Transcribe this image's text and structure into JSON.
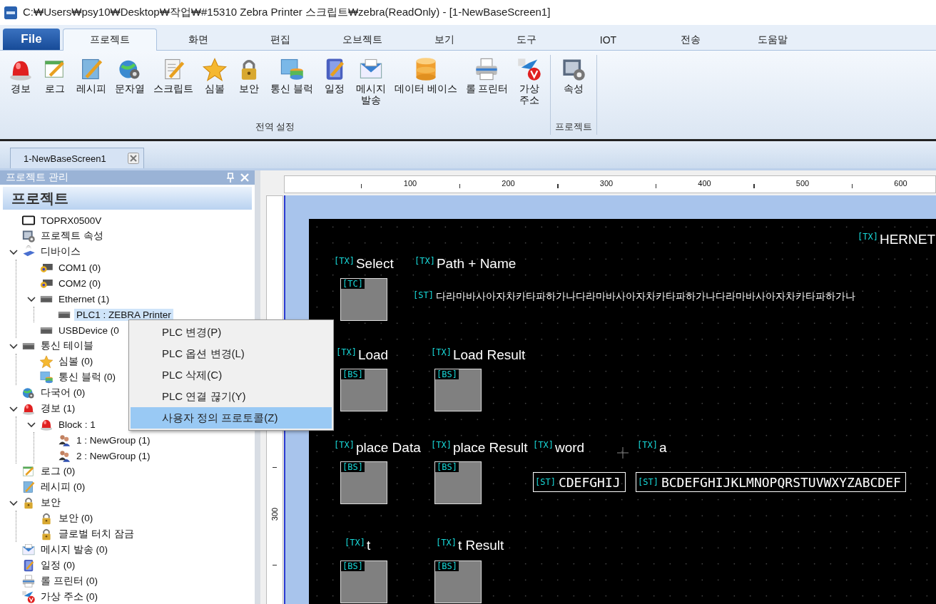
{
  "window": {
    "title": "C:₩Users₩psy10₩Desktop₩작업₩#15310 Zebra Printer 스크립트₩zebra(ReadOnly) - [1-NewBaseScreen1]"
  },
  "ribbon": {
    "tabs": [
      {
        "label": "File",
        "kind": "file",
        "selected": false
      },
      {
        "label": "프로젝트",
        "kind": "tab",
        "selected": true
      },
      {
        "label": "화면",
        "kind": "tab",
        "selected": false
      },
      {
        "label": "편집",
        "kind": "tab",
        "selected": false
      },
      {
        "label": "오브젝트",
        "kind": "tab",
        "selected": false
      },
      {
        "label": "보기",
        "kind": "tab",
        "selected": false
      },
      {
        "label": "도구",
        "kind": "tab",
        "selected": false
      },
      {
        "label": "IOT",
        "kind": "tab",
        "selected": false
      },
      {
        "label": "전송",
        "kind": "tab",
        "selected": false
      },
      {
        "label": "도움말",
        "kind": "tab",
        "selected": false
      }
    ],
    "groups": [
      {
        "label": "전역 설정",
        "buttons": [
          {
            "label": "경보",
            "kind": "alarm"
          },
          {
            "label": "로그",
            "kind": "log"
          },
          {
            "label": "레시피",
            "kind": "recipe"
          },
          {
            "label": "문자열",
            "kind": "globe"
          },
          {
            "label": "스크립트",
            "kind": "script"
          },
          {
            "label": "심볼",
            "kind": "star"
          },
          {
            "label": "보안",
            "kind": "lock"
          },
          {
            "label": "통신 블럭",
            "kind": "db"
          },
          {
            "label": "일정",
            "kind": "schedule"
          },
          {
            "label": "메시지\n발송",
            "kind": "mail"
          },
          {
            "label": "데이터 베이스",
            "kind": "database"
          },
          {
            "label": "롤 프린터",
            "kind": "printer"
          },
          {
            "label": "가상\n주소",
            "kind": "vaddr"
          }
        ]
      },
      {
        "label": "프로젝트",
        "buttons": [
          {
            "label": "속성",
            "kind": "settings"
          }
        ]
      }
    ]
  },
  "document_tabs": [
    {
      "label": "1-NewBaseScreen1",
      "selected": true
    }
  ],
  "project_panel": {
    "title": "프로젝트 관리",
    "header": "프로젝트",
    "tree": [
      {
        "label": "TOPRX0500V",
        "kind": "monitor",
        "selected": false
      },
      {
        "label": "프로젝트 속성",
        "kind": "settings",
        "selected": false
      },
      {
        "label": "디바이스",
        "kind": "network",
        "selected": false,
        "expanded": true,
        "children": [
          {
            "label": "COM1 (0)",
            "kind": "port",
            "selected": false
          },
          {
            "label": "COM2 (0)",
            "kind": "port",
            "selected": false
          },
          {
            "label": "Ethernet (1)",
            "kind": "device",
            "selected": false,
            "expanded": true,
            "children": [
              {
                "label": "PLC1 : ZEBRA Printer",
                "kind": "device",
                "selected": true
              }
            ]
          },
          {
            "label": "USBDevice (0",
            "kind": "device",
            "selected": false
          }
        ]
      },
      {
        "label": "통신 테이블",
        "kind": "device",
        "selected": false,
        "expanded": true,
        "children": [
          {
            "label": "심볼 (0)",
            "kind": "star",
            "selected": false
          },
          {
            "label": "통신 블럭 (0)",
            "kind": "db",
            "selected": false
          }
        ]
      },
      {
        "label": "다국어 (0)",
        "kind": "globe",
        "selected": false
      },
      {
        "label": "경보 (1)",
        "kind": "alarm",
        "selected": false,
        "expanded": true,
        "children": [
          {
            "label": "Block : 1",
            "kind": "alarm",
            "selected": false,
            "expanded": true,
            "children": [
              {
                "label": "1 : NewGroup (1)",
                "kind": "group",
                "selected": false
              },
              {
                "label": "2 : NewGroup (1)",
                "kind": "group",
                "selected": false
              }
            ]
          }
        ]
      },
      {
        "label": "로그 (0)",
        "kind": "log",
        "selected": false
      },
      {
        "label": "레시피 (0)",
        "kind": "recipe",
        "selected": false
      },
      {
        "label": "보안",
        "kind": "lock",
        "selected": false,
        "expanded": true,
        "children": [
          {
            "label": "보안 (0)",
            "kind": "lock",
            "selected": false
          },
          {
            "label": "글로벌 터치 잠금",
            "kind": "lock",
            "selected": false
          }
        ]
      },
      {
        "label": "메시지 발송 (0)",
        "kind": "mail",
        "selected": false
      },
      {
        "label": "일정 (0)",
        "kind": "schedule",
        "selected": false
      },
      {
        "label": "롤 프린터 (0)",
        "kind": "printer",
        "selected": false
      },
      {
        "label": "가상 주소 (0)",
        "kind": "vaddr",
        "selected": false
      }
    ]
  },
  "context_menu": [
    {
      "label": "PLC 변경(P)",
      "selected": false
    },
    {
      "label": "PLC 옵션 변경(L)",
      "selected": false
    },
    {
      "label": "PLC 삭제(C)",
      "selected": false
    },
    {
      "label": "PLC 연결 끊기(Y)",
      "selected": false
    },
    {
      "label": "사용자 정의 프로토콜(Z)",
      "selected": true
    }
  ],
  "ruler": {
    "horizontal": [
      "100",
      "200",
      "300",
      "400",
      "500",
      "600"
    ],
    "vertical": [
      "300"
    ]
  },
  "screen_objects": [
    {
      "kind": "label",
      "tag": "[TX]",
      "text": "HERNET"
    },
    {
      "kind": "label",
      "tag": "[TX]",
      "text": "Select"
    },
    {
      "kind": "label",
      "tag": "[TX]",
      "text": "Path + Name"
    },
    {
      "kind": "box",
      "tag": "[TC]"
    },
    {
      "kind": "string",
      "tag": "[ST]",
      "text": "다라마바사아자차카타파하가나다라마바사아자차카타파하가나다라마바사아자차카타파하가나"
    },
    {
      "kind": "label",
      "tag": "[TX]",
      "text": "Load"
    },
    {
      "kind": "label",
      "tag": "[TX]",
      "text": "Load Result"
    },
    {
      "kind": "box",
      "tag": "[BS]"
    },
    {
      "kind": "box",
      "tag": "[BS]"
    },
    {
      "kind": "label",
      "tag": "[TX]",
      "text": "place Data"
    },
    {
      "kind": "label",
      "tag": "[TX]",
      "text": "place Result"
    },
    {
      "kind": "label",
      "tag": "[TX]",
      "text": "word"
    },
    {
      "kind": "label",
      "tag": "[TX]",
      "text": "a"
    },
    {
      "kind": "box",
      "tag": "[BS]"
    },
    {
      "kind": "box",
      "tag": "[BS]"
    },
    {
      "kind": "field",
      "tag": "[ST]",
      "text": "CDEFGHIJ"
    },
    {
      "kind": "field",
      "tag": "[ST]",
      "text": "BCDEFGHIJKLMNOPQRSTUVWXYZABCDEF"
    },
    {
      "kind": "label",
      "tag": "[TX]",
      "text": "t"
    },
    {
      "kind": "label",
      "tag": "[TX]",
      "text": "t Result"
    },
    {
      "kind": "box",
      "tag": "[BS]"
    },
    {
      "kind": "box",
      "tag": "[BS]"
    }
  ]
}
